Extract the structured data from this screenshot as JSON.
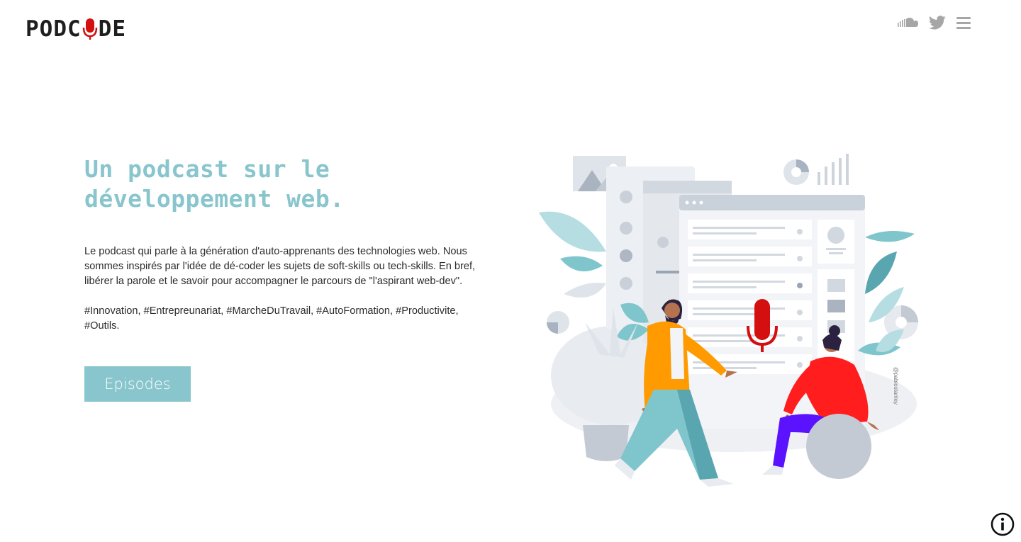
{
  "logo": {
    "text_left": "PODC",
    "text_right": "DE"
  },
  "hero": {
    "title": "Un podcast sur le développement web.",
    "description": "Le podcast qui parle à la génération d'auto-apprenants des technologies web. Nous sommes inspirés par l'idée de dé-coder les sujets de soft-skills ou tech-skills. En bref, libérer la parole et le savoir pour accompagner le parcours de \"l'aspirant web-dev\".",
    "tags": "#Innovation, #Entrepreunariat, #MarcheDuTravail, #AutoFormation, #Productivite, #Outils.",
    "cta_label": "Episodes"
  },
  "illustration": {
    "credit": "@pablostanley"
  },
  "nav_icons": [
    "soundcloud-icon",
    "twitter-icon",
    "menu-icon"
  ],
  "colors": {
    "accent": "#88c5cd",
    "mic_red": "#d30f0f",
    "text": "#2b2b2b",
    "icon_gray": "#a6a6a6"
  }
}
